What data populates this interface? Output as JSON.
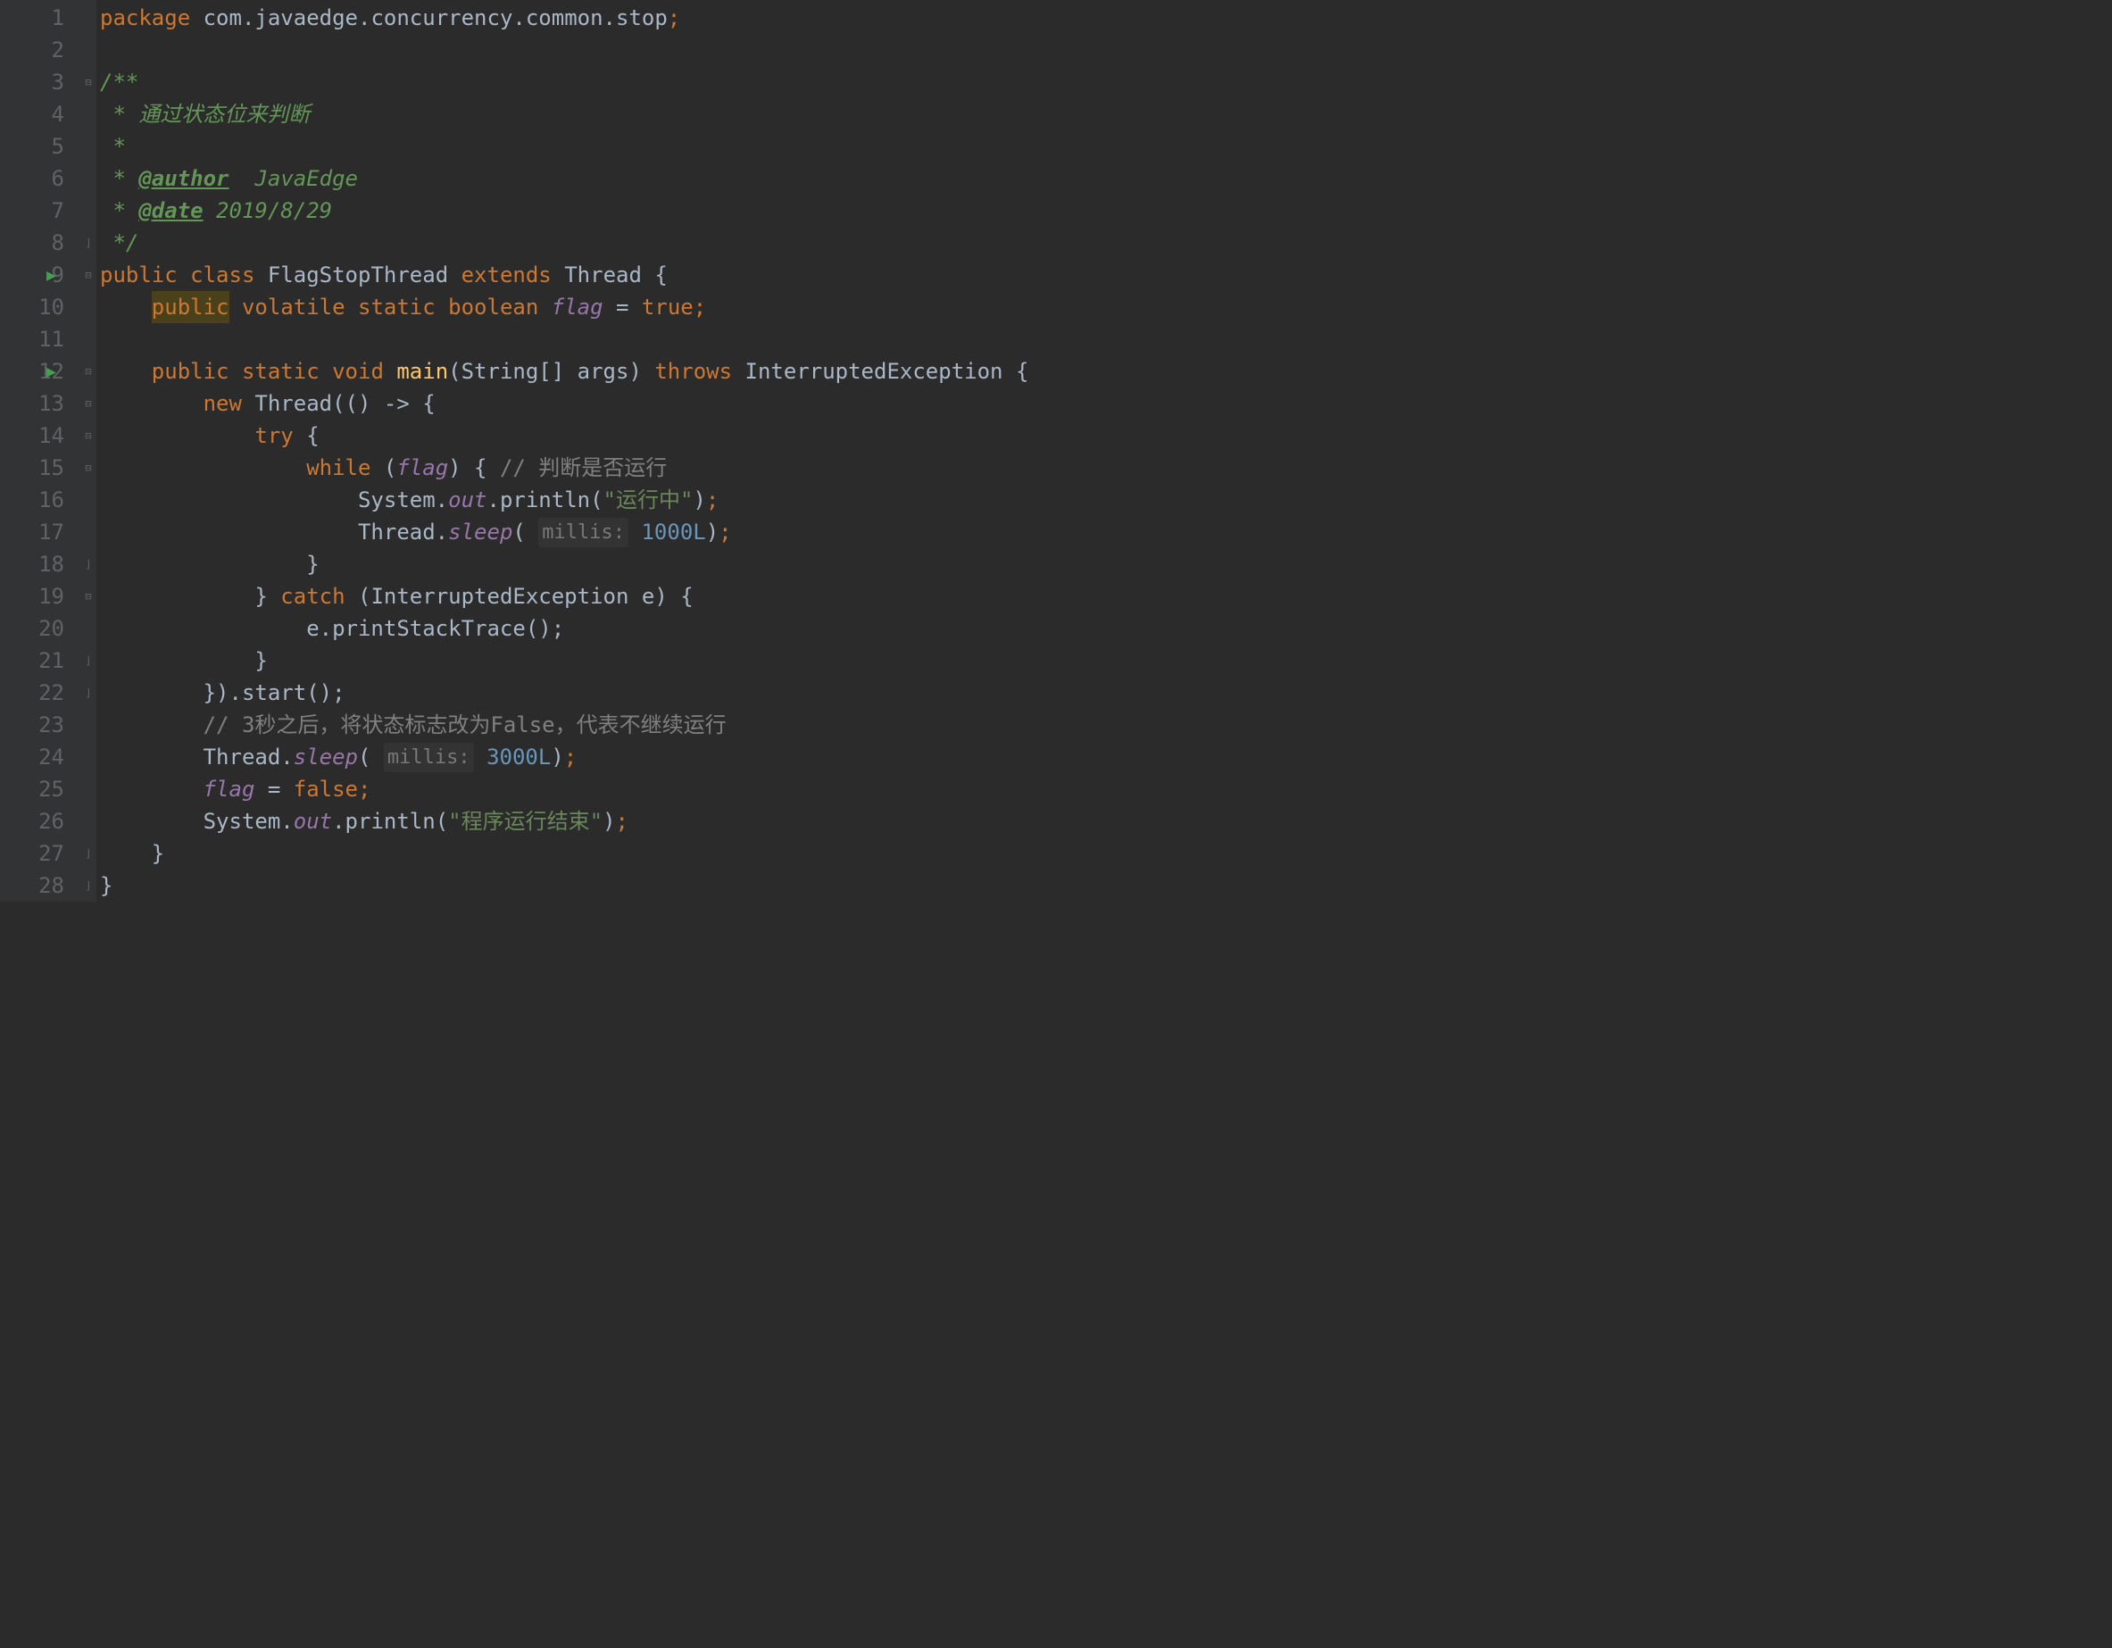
{
  "gutter": {
    "lines": [
      "1",
      "2",
      "3",
      "4",
      "5",
      "6",
      "7",
      "8",
      "9",
      "10",
      "11",
      "12",
      "13",
      "14",
      "15",
      "16",
      "17",
      "18",
      "19",
      "20",
      "21",
      "22",
      "23",
      "24",
      "25",
      "26",
      "27",
      "28"
    ],
    "run_markers": [
      9,
      12
    ]
  },
  "code": {
    "l1": {
      "package": "package",
      "pkg_name": "com.javaedge.concurrency.common.stop",
      "semi": ";"
    },
    "l3": {
      "text": "/**"
    },
    "l4": {
      "star": " * ",
      "text": "通过状态位来判断"
    },
    "l5": {
      "text": " *"
    },
    "l6": {
      "star": " * ",
      "tag": "@author",
      "value": "  JavaEdge"
    },
    "l7": {
      "star": " * ",
      "tag": "@date",
      "value": " 2019/8/29"
    },
    "l8": {
      "text": " */"
    },
    "l9": {
      "public": "public",
      "class": "class",
      "name": "FlagStopThread",
      "extends": "extends",
      "parent": "Thread",
      "brace": "{"
    },
    "l10": {
      "public": "public",
      "volatile": "volatile",
      "static": "static",
      "boolean": "boolean",
      "var": "flag",
      "eq": " = ",
      "true": "true",
      "semi": ";"
    },
    "l12": {
      "public": "public",
      "static": "static",
      "void": "void",
      "name": "main",
      "params": "(String[] args)",
      "throws": "throws",
      "exc": "InterruptedException",
      "brace": " {"
    },
    "l13": {
      "new": "new",
      "thread": " Thread(() -> {"
    },
    "l14": {
      "try": "try",
      "brace": " {"
    },
    "l15": {
      "while": "while",
      "open": " (",
      "flag": "flag",
      "close": ") { ",
      "comment": "// 判断是否运行"
    },
    "l16": {
      "sys": "System.",
      "out": "out",
      "dot": ".println(",
      "str": "\"运行中\"",
      "end": ");"
    },
    "l17": {
      "thread": "Thread.",
      "sleep": "sleep",
      "open": "( ",
      "hint": "millis:",
      "val": "1000L",
      "end": ");"
    },
    "l18": {
      "brace": "}"
    },
    "l19": {
      "brace": "} ",
      "catch": "catch",
      "params": " (InterruptedException e) {"
    },
    "l20": {
      "text": "e.printStackTrace();"
    },
    "l21": {
      "brace": "}"
    },
    "l22": {
      "text": "}).start();"
    },
    "l23": {
      "comment": "// 3秒之后，将状态标志改为False，代表不继续运行"
    },
    "l24": {
      "thread": "Thread.",
      "sleep": "sleep",
      "open": "( ",
      "hint": "millis:",
      "val": "3000L",
      "end": ");"
    },
    "l25": {
      "flag": "flag",
      "eq": " = ",
      "false": "false",
      "semi": ";"
    },
    "l26": {
      "sys": "System.",
      "out": "out",
      "dot": ".println(",
      "str": "\"程序运行结束\"",
      "end": ");"
    },
    "l27": {
      "brace": "}"
    },
    "l28": {
      "brace": "}"
    }
  }
}
